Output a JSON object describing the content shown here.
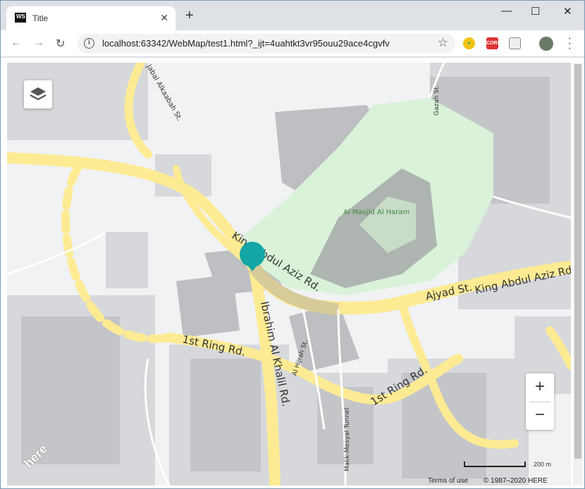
{
  "browser": {
    "tab_title": "Title",
    "tab_favicon": "WS",
    "url": "localhost:63342/WebMap/test1.html?_ijt=4uahtkt3vr95ouu29ace4cgvfv",
    "ext_cors": "CORS"
  },
  "map": {
    "place_label": "Al Masjid Al Haram",
    "roads": {
      "r1": "King Abdul Aziz Rd.",
      "r2": "Ajyad St.",
      "r3": "King Abdul Aziz Rd",
      "r4": "Ibrahim Al Khalil Rd.",
      "r5": "1st Ring Rd.",
      "r6": "1st Ring Rd.",
      "r7": "Al Hijrah St.",
      "r8": "Malik-Mesyal Tunnel",
      "r9": "Jabal Alkaabah St.",
      "r10": "Gazah St."
    },
    "zoom_in": "+",
    "zoom_out": "−",
    "scale_label": "200 m",
    "terms": "Terms of use",
    "copyright": "© 1987–2020 HERE",
    "logo": "here",
    "marker_color": "#14a6a6",
    "road_color": "#fdeb94",
    "park_color": "#d9f2d9"
  }
}
